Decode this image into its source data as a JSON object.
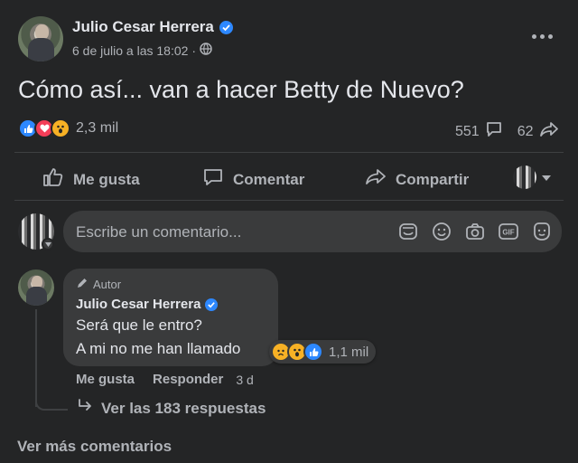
{
  "post": {
    "author": "Julio Cesar Herrera",
    "timestamp": "6 de julio a las 18:02 ·",
    "text": "Cómo así... van a hacer Betty de Nuevo?",
    "reaction_count": "2,3 mil",
    "comment_count": "551",
    "share_count": "62",
    "more_icon": "ellipsis-icon",
    "privacy_icon": "globe-icon"
  },
  "actions": {
    "like": "Me gusta",
    "comment": "Comentar",
    "share": "Compartir"
  },
  "composer": {
    "placeholder": "Escribe un comentario...",
    "icons": [
      "sticker-icon",
      "emoji-icon",
      "camera-icon",
      "gif-icon",
      "avatar-sticker-icon"
    ]
  },
  "comment": {
    "badge": "Autor",
    "author": "Julio Cesar Herrera",
    "line1": "Será que le entro?",
    "line2": "A mi no me han llamado",
    "reaction_count": "1,1 mil",
    "like_label": "Me gusta",
    "reply_label": "Responder",
    "age": "3 d",
    "replies_link": "Ver las 183 respuestas"
  },
  "footer": {
    "more_comments": "Ver más comentarios"
  },
  "colors": {
    "background": "#242526",
    "input": "#3a3b3c",
    "text": "#e4e6eb",
    "muted": "#b0b3b8",
    "verified": "#2d88ff",
    "like": "#2d88ff",
    "love": "#f33e58",
    "wow": "#f7b125"
  }
}
